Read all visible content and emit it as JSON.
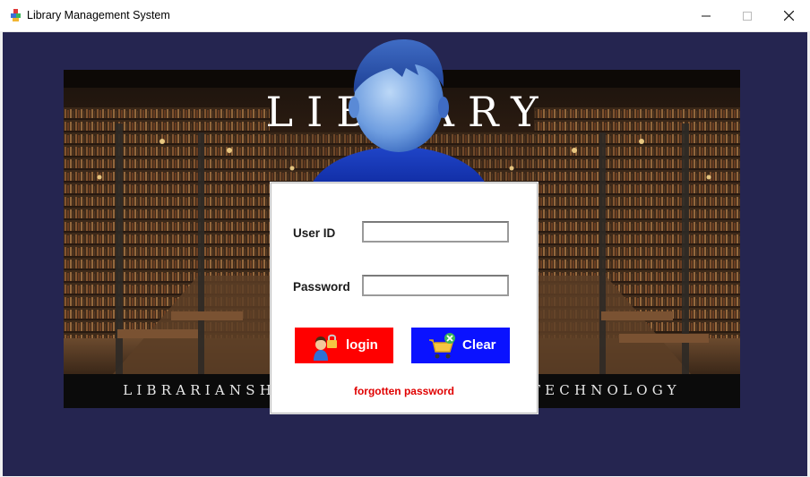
{
  "window": {
    "title": "Library Management System",
    "minimize_glyph": "—",
    "maximize_glyph": "☐",
    "close_glyph": "✕"
  },
  "banner": {
    "title": "LIBRARY",
    "tagline": "LIBRARIANSHIP AND INFORMATION TECHNOLOGY"
  },
  "login": {
    "user_id_label": "User ID",
    "user_id_value": "",
    "password_label": "Password",
    "password_value": "",
    "login_button": "login",
    "clear_button": "Clear",
    "forgot_link": "forgotten password"
  },
  "colors": {
    "background": "#252550",
    "login_button": "#ff0000",
    "clear_button": "#0a12ff",
    "forgot_link": "#e00000"
  },
  "icons": {
    "app": "library-app-icon",
    "avatar": "user-avatar-icon",
    "login": "user-lock-icon",
    "clear": "cart-clear-icon"
  }
}
